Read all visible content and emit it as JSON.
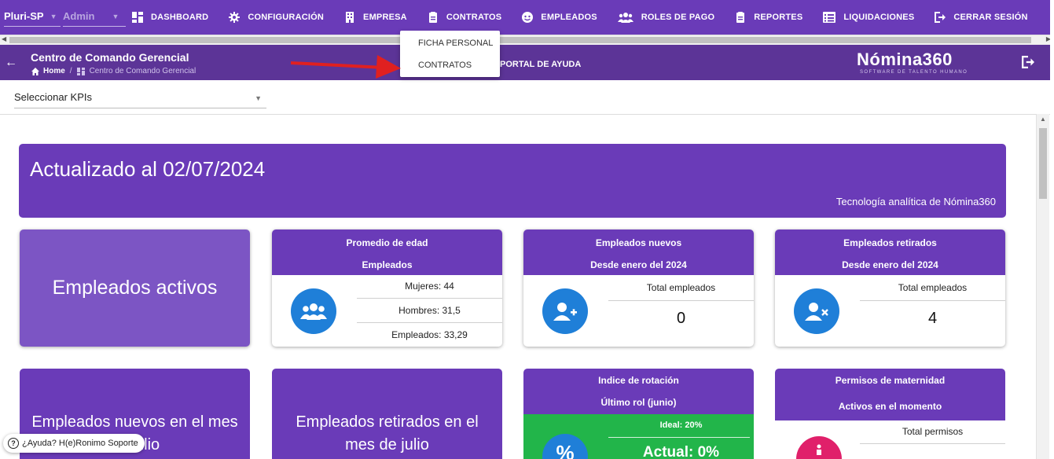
{
  "topnav": {
    "company": "Pluri-SP",
    "role": "Admin",
    "items": [
      {
        "label": "DASHBOARD",
        "icon": "dashboard-icon"
      },
      {
        "label": "CONFIGURACIÓN",
        "icon": "gear-icon"
      },
      {
        "label": "EMPRESA",
        "icon": "building-icon"
      },
      {
        "label": "CONTRATOS",
        "icon": "clipboard-icon"
      },
      {
        "label": "EMPLEADOS",
        "icon": "face-icon"
      },
      {
        "label": "ROLES DE PAGO",
        "icon": "users-icon"
      },
      {
        "label": "REPORTES",
        "icon": "clipboard-icon"
      },
      {
        "label": "LIQUIDACIONES",
        "icon": "list-icon"
      },
      {
        "label": "CERRAR SESIÓN",
        "icon": "logout-icon"
      }
    ]
  },
  "dropdown": {
    "items": [
      "FICHA PERSONAL",
      "CONTRATOS"
    ]
  },
  "header": {
    "title": "Centro de Comando Gerencial",
    "breadcrumb_home": "Home",
    "breadcrumb_current": "Centro de Comando Gerencial",
    "help_portal": "PORTAL DE AYUDA",
    "logo": "Nómina360",
    "logo_sub": "SOFTWARE DE TALENTO HUMANO"
  },
  "kpi": {
    "placeholder": "Seleccionar KPIs"
  },
  "banner": {
    "title": "Actualizado al 02/07/2024",
    "subtitle": "Tecnología analítica de Nómina360"
  },
  "cards": {
    "active": "Empleados activos",
    "age": {
      "l1": "Promedio de edad",
      "l2": "Empleados",
      "mujeres": "Mujeres: 44",
      "hombres": "Hombres: 31,5",
      "empleados": "Empleados: 33,29"
    },
    "new": {
      "l1": "Empleados nuevos",
      "l2": "Desde enero del 2024",
      "label": "Total empleados",
      "value": "0"
    },
    "retired": {
      "l1": "Empleados retirados",
      "l2": "Desde enero del 2024",
      "label": "Total empleados",
      "value": "4"
    },
    "new_month": "Empleados nuevos en el mes de julio",
    "retired_month": "Empleados retirados en el mes de julio",
    "rotation": {
      "l1": "Indice de rotación",
      "l2": "Último rol (junio)",
      "ideal": "Ideal: 20%",
      "actual": "Actual: 0%"
    },
    "maternity": {
      "l1": "Permisos de maternidad",
      "l2": "Activos en el momento",
      "label": "Total permisos"
    }
  },
  "help_pill": {
    "label": "¿Ayuda? H(e)Ronimo Soporte"
  },
  "colors": {
    "primary": "#6a3bb8",
    "header": "#5c3497",
    "accent_blue": "#1f7fd8",
    "green": "#22b54a",
    "pink": "#e0206a"
  }
}
